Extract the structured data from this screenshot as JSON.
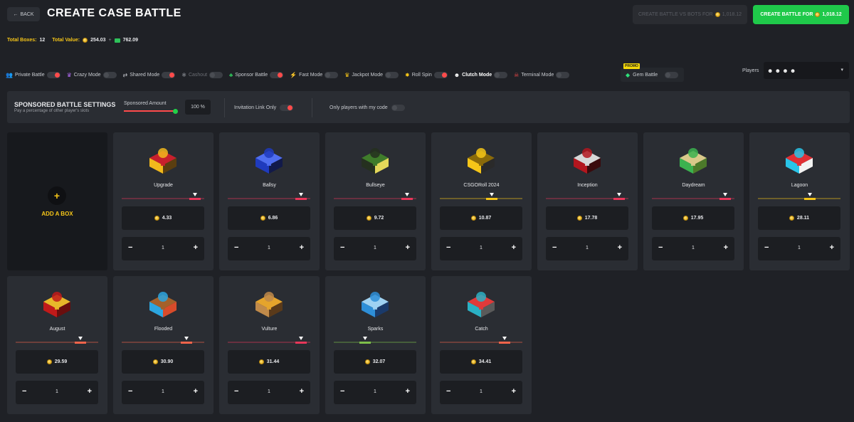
{
  "header": {
    "back_label": "BACK",
    "title": "CREATE CASE BATTLE",
    "bots_label": "CREATE BATTLE VS BOTS FOR",
    "bots_amount": "1,018.12",
    "create_label": "CREATE BATTLE FOR",
    "create_amount": "1,018.12"
  },
  "totals": {
    "boxes_label": "Total Boxes:",
    "boxes_value": "12",
    "value_label": "Total Value:",
    "coin_value": "254.03",
    "sep": "+",
    "cash_value": "762.09"
  },
  "modes": [
    {
      "label": "Private Battle",
      "icon": "people-icon",
      "glyph": "👥",
      "on": true,
      "style": ""
    },
    {
      "label": "Crazy Mode",
      "icon": "crown-icon",
      "glyph": "♛",
      "on": false,
      "style": ""
    },
    {
      "label": "Shared Mode",
      "icon": "share-icon",
      "glyph": "⇄",
      "on": true,
      "style": ""
    },
    {
      "label": "Cashout",
      "icon": "cashout-icon",
      "glyph": "✱",
      "on": false,
      "style": "dim"
    },
    {
      "label": "Sponsor Battle",
      "icon": "sponsor-icon",
      "glyph": "♣",
      "on": true,
      "style": ""
    },
    {
      "label": "Fast Mode",
      "icon": "lightning-icon",
      "glyph": "⚡",
      "on": false,
      "style": ""
    },
    {
      "label": "Jackpot Mode",
      "icon": "jackpot-crown-icon",
      "glyph": "♛",
      "on": false,
      "style": ""
    },
    {
      "label": "Roll Spin",
      "icon": "roll-spin-icon",
      "glyph": "✸",
      "on": true,
      "style": ""
    },
    {
      "label": "Clutch Mode",
      "icon": "clutch-icon",
      "glyph": "☻",
      "on": false,
      "style": "bold"
    },
    {
      "label": "Terminal Mode",
      "icon": "terminal-icon",
      "glyph": "☠",
      "on": false,
      "style": ""
    }
  ],
  "gem_battle": {
    "promo": "PROMO",
    "label": "Gem Battle"
  },
  "players": {
    "label": "Players",
    "value": "☻ ☻ ☻ ☻",
    "chevron": "▾"
  },
  "sponsored": {
    "title": "SPONSORED BATTLE SETTINGS",
    "subtitle": "Pay a percentage of other player's slots",
    "amount_label": "Sponsored Amount",
    "percent": "100 %",
    "invite_label": "Invitation Link Only",
    "invite_on": true,
    "code_label": "Only players with my code",
    "code_on": false
  },
  "add_box_label": "ADD A BOX",
  "add_box_plus": "+",
  "cases": [
    {
      "name": "Upgrade",
      "price": "4.33",
      "qty": "1",
      "rarity_color": "#e8375a",
      "rarity_tier": 0.96,
      "colors": [
        "#f2b91c",
        "#c7202c",
        "#5a3e10"
      ]
    },
    {
      "name": "Ballsy",
      "price": "6.86",
      "qty": "1",
      "rarity_color": "#e8375a",
      "rarity_tier": 0.96,
      "colors": [
        "#1f3bbd",
        "#4f6ef0",
        "#121a4a"
      ]
    },
    {
      "name": "Bullseye",
      "price": "9.72",
      "qty": "1",
      "rarity_color": "#e8375a",
      "rarity_tier": 0.96,
      "colors": [
        "#25301f",
        "#3f7c2b",
        "#e4d85a"
      ]
    },
    {
      "name": "CSGORoll 2024",
      "price": "10.87",
      "qty": "1",
      "rarity_color": "#f5c518",
      "rarity_tier": 0.7,
      "colors": [
        "#f5c518",
        "#8a6a0a",
        "#2a2a2a"
      ]
    },
    {
      "name": "Inception",
      "price": "17.78",
      "qty": "1",
      "rarity_color": "#e8375a",
      "rarity_tier": 0.96,
      "colors": [
        "#b3161e",
        "#d8d8d8",
        "#3a0a0c"
      ]
    },
    {
      "name": "Daydream",
      "price": "17.95",
      "qty": "1",
      "rarity_color": "#e8375a",
      "rarity_tier": 0.96,
      "colors": [
        "#3bb24f",
        "#d9c98a",
        "#4c7a2a"
      ]
    },
    {
      "name": "Lagoon",
      "price": "28.11",
      "qty": "1",
      "rarity_color": "#f5c518",
      "rarity_tier": 0.7,
      "colors": [
        "#29c4e8",
        "#e02f34",
        "#f2f2f2"
      ]
    },
    {
      "name": "August",
      "price": "29.59",
      "qty": "1",
      "rarity_color": "#f4644b",
      "rarity_tier": 0.85,
      "colors": [
        "#c11a1a",
        "#e8b82a",
        "#6a0e0e"
      ]
    },
    {
      "name": "Flooded",
      "price": "30.90",
      "qty": "1",
      "rarity_color": "#f4644b",
      "rarity_tier": 0.85,
      "colors": [
        "#2ca6e0",
        "#a4612a",
        "#d84b2a"
      ]
    },
    {
      "name": "Vulture",
      "price": "31.44",
      "qty": "1",
      "rarity_color": "#e8375a",
      "rarity_tier": 0.96,
      "colors": [
        "#c08a4a",
        "#e5a42c",
        "#5a3a1a"
      ]
    },
    {
      "name": "Sparks",
      "price": "32.07",
      "qty": "1",
      "rarity_color": "#7fbf4a",
      "rarity_tier": 0.45,
      "colors": [
        "#2e8fd8",
        "#9fd2f2",
        "#1a3a6a"
      ]
    },
    {
      "name": "Catch",
      "price": "34.41",
      "qty": "1",
      "rarity_color": "#f4644b",
      "rarity_tier": 0.85,
      "colors": [
        "#2ab0c4",
        "#e03a3a",
        "#5a5a5a"
      ]
    }
  ],
  "qty_minus": "−",
  "qty_plus": "+"
}
